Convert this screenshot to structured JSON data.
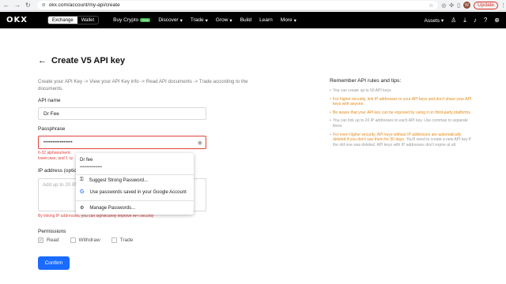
{
  "browser": {
    "url": "okx.com/account/my-api/create",
    "update_label": "Update",
    "profile_initial": "W"
  },
  "header": {
    "logo": "OKX",
    "toggle": [
      "Exchange",
      "Wallet"
    ],
    "menu": [
      {
        "label": "Buy Crypto",
        "badge": "New"
      },
      {
        "label": "Discover",
        "caret": "▾"
      },
      {
        "label": "Trade",
        "caret": "▾"
      },
      {
        "label": "Grow",
        "caret": "▾"
      },
      {
        "label": "Build"
      },
      {
        "label": "Learn"
      },
      {
        "label": "More",
        "caret": "▾"
      }
    ],
    "assets_label": "Assets",
    "assets_caret": "▾"
  },
  "page": {
    "back_arrow": "←",
    "title": "Create V5 API key",
    "breadcrumb": "Create your API Key -> View your API Key info -> Read API documents -> Trade according to the documents."
  },
  "form": {
    "api_name_label": "API name",
    "api_name_value": "Dr Fee",
    "passphrase_label": "Passphrase",
    "passphrase_value": "••••••••••••••••",
    "passphrase_error": "6-32 alphanumeric lowercase, and 1 sy",
    "ip_label": "IP address (optic",
    "ip_placeholder": "Add up to 20 IP",
    "ip_hint": "By linking IP addresses, you can significantly improve API security",
    "permissions_label": "Permissions",
    "permissions": [
      {
        "label": "Read",
        "checked": true
      },
      {
        "label": "Withdraw",
        "checked": false
      },
      {
        "label": "Trade",
        "checked": false
      }
    ],
    "confirm_label": "Confirm"
  },
  "password_popup": {
    "saved_name": "Dr fee",
    "saved_dots": "••••••••••••••••",
    "suggest_label": "Suggest Strong Password...",
    "google_label": "Use passwords saved in your Google Account",
    "manage_label": "Manage Passwords..."
  },
  "rules": {
    "title": "Remember API rules and tips:",
    "items": [
      {
        "text": "You can create up to 50 API keys.",
        "highlight": ""
      },
      {
        "text": "For higher security, link IP addresses to your API keys and don't share your API keys with anyone.",
        "highlight": "all"
      },
      {
        "text": "Be aware that your API key can be exposed by using it on third-party platforms.",
        "highlight": "all"
      },
      {
        "text": "You can link up to 20 IP addresses to each API key. Use commas to separate them.",
        "highlight": ""
      },
      {
        "text_hl": "For even higher security, API keys without IP addresses are automatically deleted if you don't use them for 30 days.",
        "text_rest": " You'll need to create a new API key if the old one was deleted. API keys with IP addresses don't expire at all."
      }
    ]
  }
}
